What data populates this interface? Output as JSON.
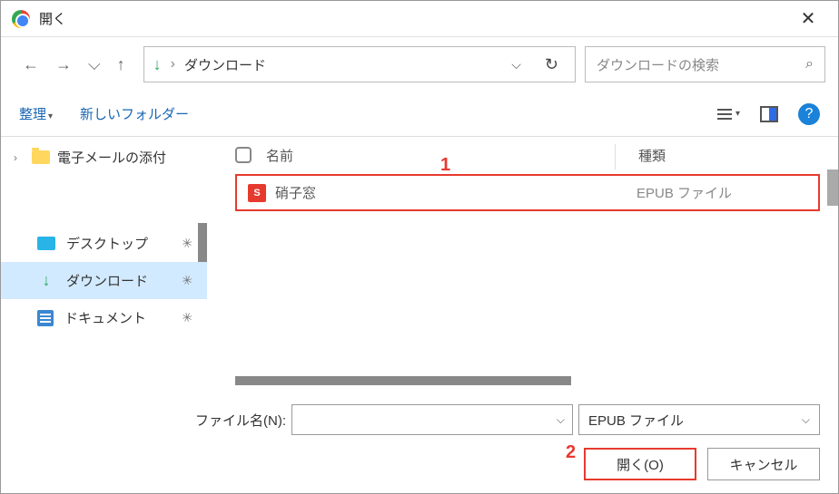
{
  "title": "開く",
  "path": {
    "download_label": "ダウンロード"
  },
  "search": {
    "placeholder": "ダウンロードの検索"
  },
  "toolbar": {
    "organize": "整理",
    "new_folder": "新しいフォルダー"
  },
  "sidebar": {
    "email_attachments": "電子メールの添付",
    "desktop": "デスクトップ",
    "downloads": "ダウンロード",
    "documents": "ドキュメント"
  },
  "columns": {
    "name": "名前",
    "type": "種類"
  },
  "files": [
    {
      "icon_label": "S",
      "name": "硝子窓",
      "type": "EPUB ファイル"
    }
  ],
  "annotations": {
    "one": "1",
    "two": "2"
  },
  "bottom": {
    "filename_label": "ファイル名(N):",
    "filter": "EPUB ファイル",
    "open_button": "開く(O)",
    "cancel_button": "キャンセル"
  }
}
